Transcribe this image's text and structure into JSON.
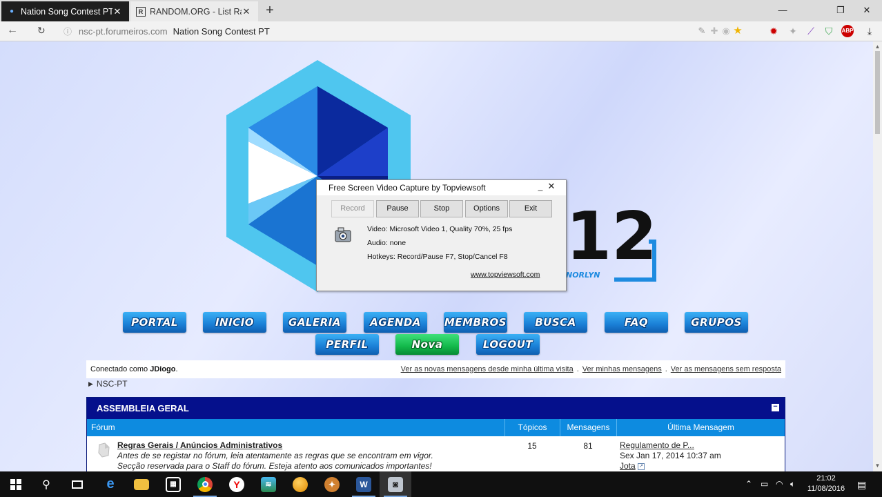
{
  "browser": {
    "tabs": [
      {
        "title": "Nation Song Contest PT",
        "active": true
      },
      {
        "title": "RANDOM.ORG - List Randor",
        "active": false
      }
    ],
    "new_tab": "+",
    "url_host": "nsc-pt.forumeiros.com",
    "url_page_title": "Nation Song Contest PT",
    "window_controls": {
      "minimize": "—",
      "maximize": "❐",
      "close": "✕"
    }
  },
  "nav": {
    "row1": [
      "PORTAL",
      "INICIO",
      "GALERIA",
      "AGENDA",
      "MEMBROS",
      "BUSCA",
      "FAQ",
      "GRUPOS"
    ],
    "row2": [
      "PERFIL",
      "Nova",
      "LOGOUT"
    ]
  },
  "logo": {
    "text_large": "12",
    "text_small": "NORLYN"
  },
  "userbar": {
    "connected_prefix": "Conectado como ",
    "username": "JDiogo",
    "connected_suffix": ".",
    "links": [
      "Ver as novas mensagens desde minha última visita",
      "Ver minhas mensagens",
      "Ver as mensagens sem resposta"
    ],
    "separator": "."
  },
  "breadcrumb": {
    "label": "NSC-PT"
  },
  "forum": {
    "category": "ASSEMBLEIA GERAL",
    "collapse": "−",
    "columns": [
      "Fórum",
      "Tópicos",
      "Mensagens",
      "Última Mensagem"
    ],
    "rows": [
      {
        "title": "Regras Gerais / Anúncios Administrativos",
        "desc_line1": "Antes de se registar no fórum, leia atentamente as regras que se encontram em vigor.",
        "desc_line2": "Secção reservada para o Staff do fórum. Esteja atento aos comunicados importantes!",
        "topics": "15",
        "messages": "81",
        "last_title": "Regulamento de P...",
        "last_date": "Sex Jan 17, 2014 10:37 am",
        "last_user": "Jota"
      }
    ]
  },
  "capture_dialog": {
    "title": "Free Screen Video Capture by Topviewsoft",
    "buttons": [
      "Record",
      "Pause",
      "Stop",
      "Options",
      "Exit"
    ],
    "video": "Video: Microsoft Video 1, Quality 70%, 25 fps",
    "audio": "Audio: none",
    "hotkeys": "Hotkeys: Record/Pause F7, Stop/Cancel F8",
    "link": "www.topviewsoft.com"
  },
  "taskbar": {
    "time": "21:02",
    "date": "11/08/2016"
  },
  "colors": {
    "forum_header": "#05108c",
    "forum_columns": "#0d8be0",
    "nav_blue": "#1a7fd6",
    "nav_green": "#12b84a"
  }
}
